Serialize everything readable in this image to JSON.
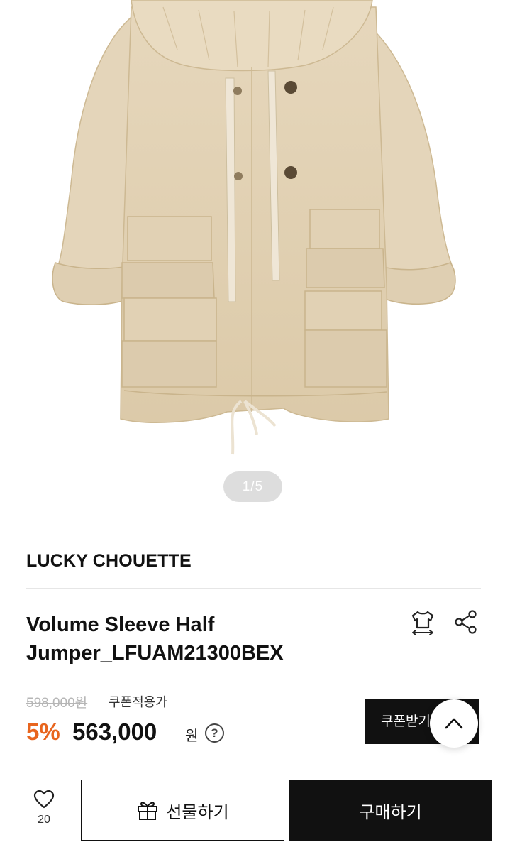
{
  "gallery": {
    "pager": "1/5"
  },
  "brand": "LUCKY CHOUETTE",
  "product": {
    "name_line1": "Volume Sleeve Half",
    "name_line2": "Jumper_LFUAM21300BEX"
  },
  "icons": {
    "size": "size-guide-icon",
    "share": "share-icon",
    "heart": "heart-icon",
    "gift": "gift-icon",
    "chevron": "chevron-up-icon"
  },
  "price": {
    "original": "598,000원",
    "coupon_note": "쿠폰적용가",
    "discount": "5%",
    "sale": "563,000",
    "currency": "원",
    "help": "?"
  },
  "coupon_button": "쿠폰받기",
  "bottom_bar": {
    "like_count": "20",
    "gift_label": "선물하기",
    "buy_label": "구매하기"
  },
  "colors": {
    "accent": "#e8651e",
    "dark": "#111111",
    "coat": "#e3d3b7"
  }
}
